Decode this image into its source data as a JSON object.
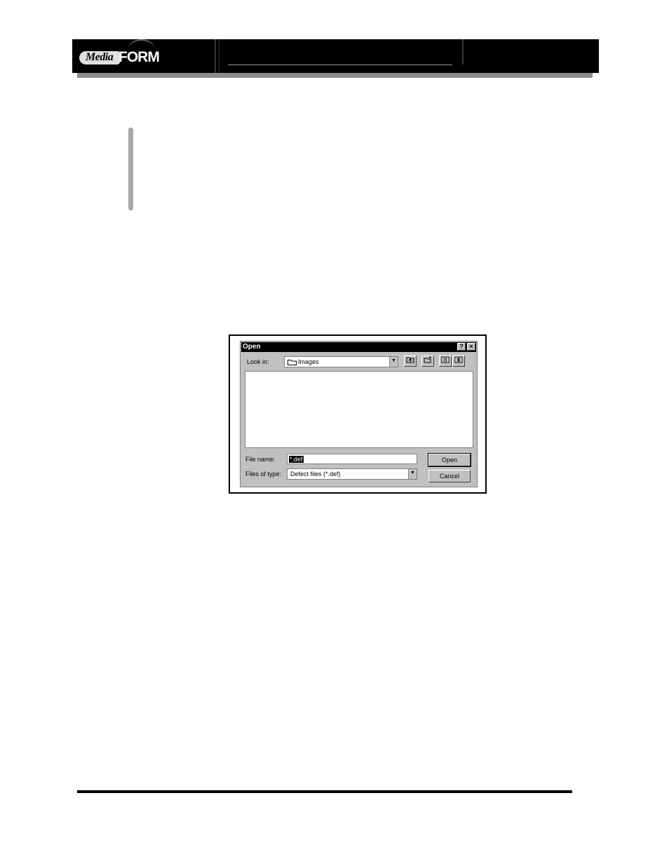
{
  "header": {
    "logo_media": "Media",
    "logo_form": "FORM"
  },
  "dialog": {
    "title": "Open",
    "help_button": "?",
    "close_button": "×",
    "look_in_label": "Look in:",
    "look_in_value": "Images",
    "file_name_label": "File name:",
    "file_name_value": "*.def",
    "files_of_type_label": "Files of type:",
    "files_of_type_value": "Defect files (*.def)",
    "open_button": "Open",
    "cancel_button": "Cancel"
  }
}
